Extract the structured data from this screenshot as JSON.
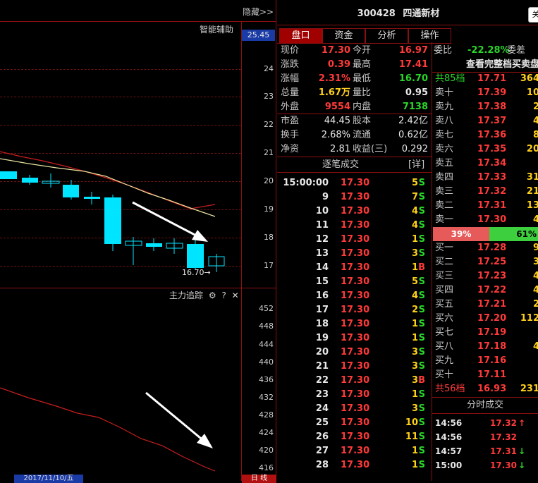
{
  "chart": {
    "hide_label": "隐藏>>",
    "assist_label": "智能辅助",
    "price_tag": "25.45",
    "low_label": "16.70→",
    "upper_ticks": [
      "24",
      "23",
      "22",
      "21",
      "20",
      "19",
      "18",
      "17"
    ],
    "main_track_label": "主力追踪",
    "lower_ticks": [
      "452",
      "448",
      "444",
      "440",
      "436",
      "432",
      "428",
      "424",
      "420",
      "416"
    ],
    "date_label": "2017/11/10/五",
    "bottom_tag": "日 线"
  },
  "stock": {
    "code": "300428",
    "name": "四通新材",
    "title_button": "关"
  },
  "tabs": [
    {
      "label": "盘口",
      "active": true
    },
    {
      "label": "资金",
      "active": false
    },
    {
      "label": "分析",
      "active": false
    },
    {
      "label": "操作",
      "active": false
    }
  ],
  "quote": [
    {
      "l1": "现价",
      "v1": "17.30",
      "c1": "red",
      "l2": "今开",
      "v2": "16.97",
      "c2": "red"
    },
    {
      "l1": "涨跌",
      "v1": "0.39",
      "c1": "red",
      "l2": "最高",
      "v2": "17.41",
      "c2": "red"
    },
    {
      "l1": "涨幅",
      "v1": "2.31%",
      "c1": "red",
      "l2": "最低",
      "v2": "16.70",
      "c2": "green"
    },
    {
      "l1": "总量",
      "v1": "1.67万",
      "c1": "yellow",
      "l2": "量比",
      "v2": "0.95",
      "c2": "white"
    },
    {
      "l1": "外盘",
      "v1": "9554",
      "c1": "red",
      "l2": "内盘",
      "v2": "7138",
      "c2": "green"
    }
  ],
  "fundamentals": [
    {
      "l1": "市盈",
      "v1": "44.45",
      "l2": "股本",
      "v2": "2.42亿"
    },
    {
      "l1": "换手",
      "v1": "2.68%",
      "l2": "流通",
      "v2": "0.62亿"
    },
    {
      "l1": "净资",
      "v1": "2.81",
      "l2": "收益(三)",
      "v2": "0.292"
    }
  ],
  "trades_header": {
    "title": "逐笔成交",
    "detail": "[详]"
  },
  "trades": [
    {
      "t": "15:00:00",
      "p": "17.30",
      "v": "5",
      "d": "S"
    },
    {
      "t": "9",
      "p": "17.30",
      "v": "7",
      "d": "S"
    },
    {
      "t": "10",
      "p": "17.30",
      "v": "4",
      "d": "S"
    },
    {
      "t": "11",
      "p": "17.30",
      "v": "4",
      "d": "S"
    },
    {
      "t": "12",
      "p": "17.30",
      "v": "1",
      "d": "S"
    },
    {
      "t": "13",
      "p": "17.30",
      "v": "3",
      "d": "S"
    },
    {
      "t": "14",
      "p": "17.30",
      "v": "1",
      "d": "B"
    },
    {
      "t": "15",
      "p": "17.30",
      "v": "5",
      "d": "S"
    },
    {
      "t": "16",
      "p": "17.30",
      "v": "4",
      "d": "S"
    },
    {
      "t": "17",
      "p": "17.30",
      "v": "2",
      "d": "S"
    },
    {
      "t": "18",
      "p": "17.30",
      "v": "1",
      "d": "S"
    },
    {
      "t": "19",
      "p": "17.30",
      "v": "1",
      "d": "S"
    },
    {
      "t": "20",
      "p": "17.30",
      "v": "3",
      "d": "S"
    },
    {
      "t": "21",
      "p": "17.30",
      "v": "3",
      "d": "S"
    },
    {
      "t": "22",
      "p": "17.30",
      "v": "3",
      "d": "B"
    },
    {
      "t": "23",
      "p": "17.30",
      "v": "1",
      "d": "S"
    },
    {
      "t": "24",
      "p": "17.30",
      "v": "3",
      "d": "S"
    },
    {
      "t": "25",
      "p": "17.30",
      "v": "10",
      "d": "S"
    },
    {
      "t": "26",
      "p": "17.30",
      "v": "11",
      "d": "S"
    },
    {
      "t": "27",
      "p": "17.30",
      "v": "1",
      "d": "S"
    },
    {
      "t": "28",
      "p": "17.30",
      "v": "1",
      "d": "S"
    }
  ],
  "order_book": {
    "weibi_label": "委比",
    "weibi_value": "-22.28%",
    "weicha_label": "委差",
    "full_link": "查看完整档买卖盘",
    "ask_total": {
      "label": "共85档",
      "price": "17.71",
      "qty": "364"
    },
    "asks": [
      {
        "n": "卖十",
        "p": "17.39",
        "q": "10"
      },
      {
        "n": "卖九",
        "p": "17.38",
        "q": "2"
      },
      {
        "n": "卖八",
        "p": "17.37",
        "q": "4"
      },
      {
        "n": "卖七",
        "p": "17.36",
        "q": "8"
      },
      {
        "n": "卖六",
        "p": "17.35",
        "q": "20"
      },
      {
        "n": "卖五",
        "p": "17.34",
        "q": ""
      },
      {
        "n": "卖四",
        "p": "17.33",
        "q": "31"
      },
      {
        "n": "卖三",
        "p": "17.32",
        "q": "21"
      },
      {
        "n": "卖二",
        "p": "17.31",
        "q": "13"
      },
      {
        "n": "卖一",
        "p": "17.30",
        "q": "4"
      }
    ],
    "ratio_sell": "39%",
    "ratio_buy": "61%",
    "bids": [
      {
        "n": "买一",
        "p": "17.28",
        "q": "9"
      },
      {
        "n": "买二",
        "p": "17.25",
        "q": "3"
      },
      {
        "n": "买三",
        "p": "17.23",
        "q": "4"
      },
      {
        "n": "买四",
        "p": "17.22",
        "q": "4"
      },
      {
        "n": "买五",
        "p": "17.21",
        "q": "2"
      },
      {
        "n": "买六",
        "p": "17.20",
        "q": "112"
      },
      {
        "n": "买七",
        "p": "17.19",
        "q": ""
      },
      {
        "n": "买八",
        "p": "17.18",
        "q": "4"
      },
      {
        "n": "买九",
        "p": "17.16",
        "q": ""
      },
      {
        "n": "买十",
        "p": "17.11",
        "q": ""
      }
    ],
    "bid_total": {
      "label": "共56档",
      "price": "16.93",
      "qty": "231"
    }
  },
  "timeshare": {
    "title": "分时成交",
    "rows": [
      {
        "t": "14:56",
        "p": "17.32",
        "arrow": "up"
      },
      {
        "t": "14:56",
        "p": "17.32",
        "arrow": ""
      },
      {
        "t": "14:57",
        "p": "17.31",
        "arrow": "down"
      },
      {
        "t": "15:00",
        "p": "17.30",
        "arrow": "down"
      }
    ]
  }
}
